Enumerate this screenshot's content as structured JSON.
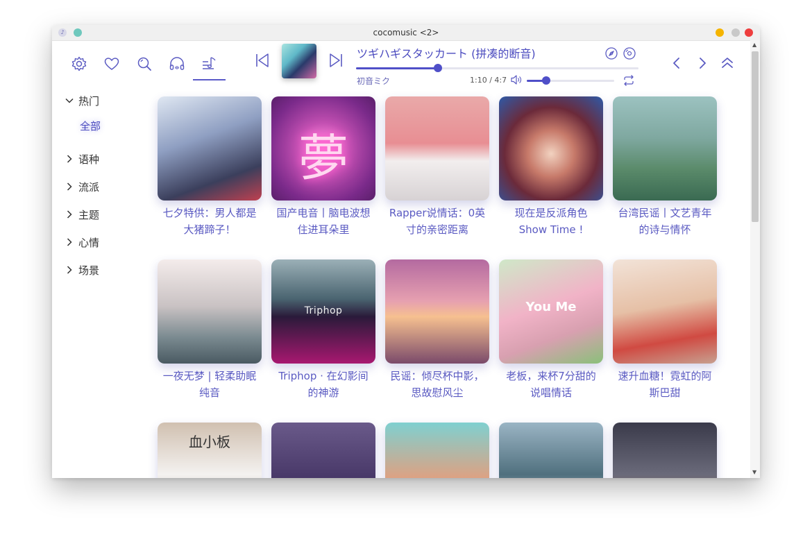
{
  "window": {
    "title": "cocomusic <2>"
  },
  "toolbar": {
    "icons": [
      "gear-icon",
      "heart-icon",
      "search-icon",
      "headphones-icon",
      "music-note-icon"
    ],
    "active": "music-note-icon"
  },
  "player": {
    "title": "ツギハギスタッカート (拼凑的断音)",
    "artist": "初音ミク",
    "time": "1:10 / 4:7",
    "progress": 0.29,
    "volume": 0.22
  },
  "sidebar": {
    "hot_label": "热门",
    "hot_selected": "全部",
    "items": [
      {
        "label": "语种"
      },
      {
        "label": "流派"
      },
      {
        "label": "主题"
      },
      {
        "label": "心情"
      },
      {
        "label": "场景"
      }
    ]
  },
  "playlists": [
    {
      "line1": "七夕特供：男人都是",
      "line2": "大猪蹄子！",
      "thumb_text": ""
    },
    {
      "line1": "国产电音丨脑电波想",
      "line2": "住进耳朵里",
      "thumb_text": "夢"
    },
    {
      "line1": "Rapper说情话：0英",
      "line2": "寸的亲密距离",
      "thumb_text": ""
    },
    {
      "line1": "现在是反派角色",
      "line2": "Show Time !",
      "thumb_text": ""
    },
    {
      "line1": "台湾民谣丨文艺青年",
      "line2": "的诗与情怀",
      "thumb_text": ""
    },
    {
      "line1": "一夜无梦 | 轻柔助眠",
      "line2": "纯音",
      "thumb_text": ""
    },
    {
      "line1": "Triphop · 在幻影间",
      "line2": "的神游",
      "thumb_text": "Triphop"
    },
    {
      "line1": "民谣：倾尽杯中影，",
      "line2": "思故慰风尘",
      "thumb_text": ""
    },
    {
      "line1": "老板，来杯7分甜的",
      "line2": "说唱情话",
      "thumb_text": "You Me"
    },
    {
      "line1": "速升血糖！霓虹的阿",
      "line2": "斯巴甜",
      "thumb_text": ""
    },
    {
      "line1": "",
      "line2": "",
      "thumb_text": "血小板"
    },
    {
      "line1": "",
      "line2": "",
      "thumb_text": ""
    },
    {
      "line1": "",
      "line2": "",
      "thumb_text": ""
    },
    {
      "line1": "",
      "line2": "",
      "thumb_text": ""
    },
    {
      "line1": "",
      "line2": "",
      "thumb_text": ""
    }
  ],
  "colors": {
    "accent": "#4b4bbf"
  }
}
